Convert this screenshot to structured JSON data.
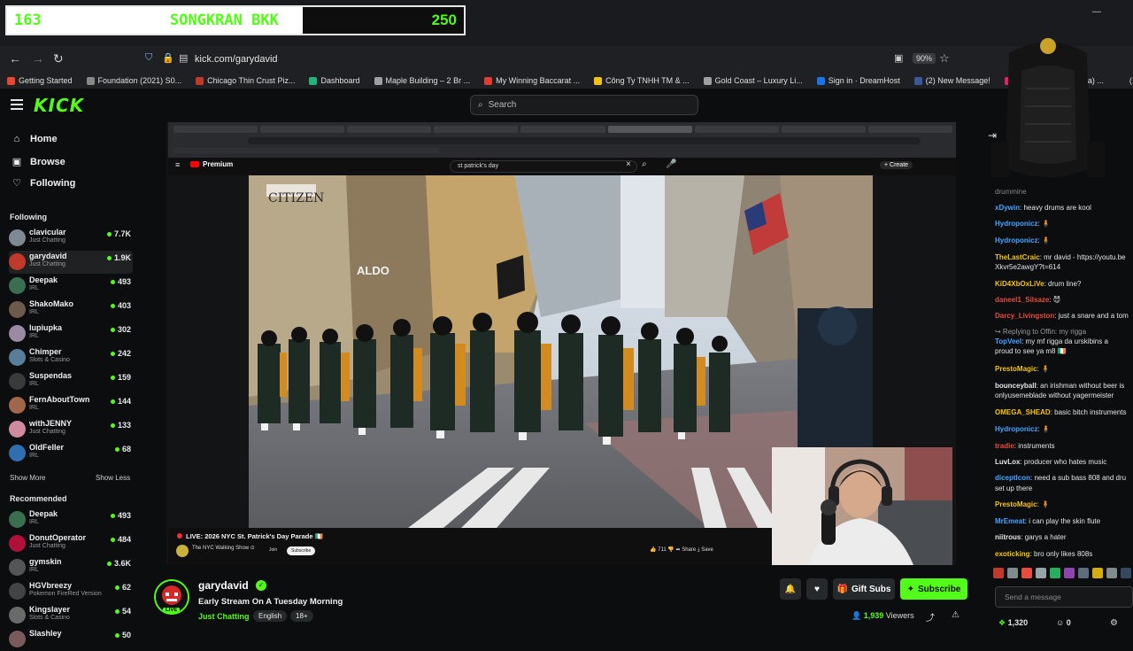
{
  "browser": {
    "overlay": {
      "left_num": "163",
      "title": "SONGKRAN BKK",
      "right_num": "250"
    },
    "url": "kick.com/garydavid",
    "zoom": "90%",
    "bookmarks": [
      {
        "label": "Getting Started",
        "color": "#e8472f"
      },
      {
        "label": "Foundation (2021) S0...",
        "color": "#888888"
      },
      {
        "label": "Chicago Thin Crust Piz...",
        "color": "#c0392b"
      },
      {
        "label": "Dashboard",
        "color": "#23b37a"
      },
      {
        "label": "Maple Building – 2 Br ...",
        "color": "#a0a0a0"
      },
      {
        "label": "My Winning Baccarat ...",
        "color": "#e03c31"
      },
      {
        "label": "Công Ty TNHH TM & ...",
        "color": "#f1c40f"
      },
      {
        "label": "Gold Coast – Luxury Li...",
        "color": "#a0a0a0"
      },
      {
        "label": "Sign in · DreamHost",
        "color": "#1a73e8"
      },
      {
        "label": "(2) New Message!",
        "color": "#3b5998"
      },
      {
        "label": "Voice (Korean Drama) ...",
        "color": "#e91e63"
      },
      {
        "label": "(1) N",
        "color": "#1f1f1f"
      }
    ]
  },
  "header": {
    "logo": "KICK",
    "search_placeholder": "Search"
  },
  "sidebar": {
    "nav": [
      {
        "label": "Home",
        "icon": "home-icon"
      },
      {
        "label": "Browse",
        "icon": "browse-icon"
      },
      {
        "label": "Following",
        "icon": "heart-icon"
      }
    ],
    "following_title": "Following",
    "following": [
      {
        "name": "clavicular",
        "category": "Just Chatting",
        "viewers": "7.7K",
        "avatar": "#7d8a93"
      },
      {
        "name": "garydavid",
        "category": "Just Chatting",
        "viewers": "1.9K",
        "avatar": "#c0392b",
        "active": true
      },
      {
        "name": "Deepak",
        "category": "IRL",
        "viewers": "493",
        "avatar": "#3b6e4f"
      },
      {
        "name": "ShakoMako",
        "category": "IRL",
        "viewers": "403",
        "avatar": "#6e5a4a"
      },
      {
        "name": "lupiupka",
        "category": "IRL",
        "viewers": "302",
        "avatar": "#9b8aa6"
      },
      {
        "name": "Chimper",
        "category": "Slots & Casino",
        "viewers": "242",
        "avatar": "#5a7d9a"
      },
      {
        "name": "Suspendas",
        "category": "IRL",
        "viewers": "159",
        "avatar": "#3a3a3a"
      },
      {
        "name": "FernAboutTown",
        "category": "IRL",
        "viewers": "144",
        "avatar": "#a0674a"
      },
      {
        "name": "withJENNY",
        "category": "Just Chatting",
        "viewers": "133",
        "avatar": "#d08aa0"
      },
      {
        "name": "OldFeller",
        "category": "IRL",
        "viewers": "68",
        "avatar": "#2f6fb0"
      }
    ],
    "show_more": "Show More",
    "show_less": "Show Less",
    "recommended_title": "Recommended",
    "recommended": [
      {
        "name": "Deepak",
        "category": "IRL",
        "viewers": "493",
        "avatar": "#3b6e4f"
      },
      {
        "name": "DonutOperator",
        "category": "Just Chatting",
        "viewers": "484",
        "avatar": "#b0103a"
      },
      {
        "name": "gymskin",
        "category": "IRL",
        "viewers": "3.6K",
        "avatar": "#555555"
      },
      {
        "name": "HGVbreezy",
        "category": "Pokemon FireRed Version",
        "viewers": "62",
        "avatar": "#444444"
      },
      {
        "name": "Kingslayer",
        "category": "Slots & Casino",
        "viewers": "54",
        "avatar": "#6a6a6a"
      },
      {
        "name": "Slashley",
        "category": "",
        "viewers": "50",
        "avatar": "#7a5a5a"
      }
    ]
  },
  "video": {
    "yt_search": "st patrick's day",
    "yt_premium": "Premium",
    "yt_title": "LIVE: 2026 NYC St. Patrick's Day Parade 🇮🇪",
    "yt_channel": "The NYC Walking Show ⊙",
    "yt_join": "Join",
    "yt_subscribe": "Subscribe",
    "yt_actions": "👍 711   👎   ➦ Share   ⤓ Save",
    "scene_signs": [
      "CITIZEN",
      "ALDO"
    ]
  },
  "stream": {
    "name": "garydavid",
    "title": "Early Stream On A Tuesday Morning",
    "category": "Just Chatting",
    "tags": [
      "English",
      "18+"
    ],
    "live": "LIVE",
    "viewers": "1,939",
    "viewers_label": "Viewers",
    "gift_subs": "Gift Subs",
    "subscribe": "Subscribe"
  },
  "chat": {
    "messages": [
      {
        "user": "xDywin",
        "color": "#4aa3ff",
        "text": "heavy drums are kool"
      },
      {
        "user": "Hydroponicz",
        "color": "#4aa3ff",
        "text": "🧍"
      },
      {
        "user": "Hydroponicz",
        "color": "#4aa3ff",
        "text": "🧍"
      },
      {
        "user": "TheLastCraic",
        "color": "#f5c518",
        "text": "mr david - https://youtu.be"
      },
      {
        "user": "",
        "color": "#e6e6e6",
        "text": "Xkvr5e2awgY?t=614"
      },
      {
        "user": "KiD4XbOxLiVe",
        "color": "#f5c518",
        "text": "drum line?"
      },
      {
        "user": "daneel1_Silsaze",
        "color": "#e74c3c",
        "text": "😈"
      },
      {
        "user": "Darcy_Livingston",
        "color": "#e74c3c",
        "text": "just a snare and a tom"
      },
      {
        "user": "",
        "color": "#9a9a9a",
        "text": "↪ Replying to Offin: my rigga"
      },
      {
        "user": "TopVeel",
        "color": "#4aa3ff",
        "text": "my mf rigga da urskibins a"
      },
      {
        "user": "",
        "color": "#e6e6e6",
        "text": "proud to see ya m8 🇮🇪"
      },
      {
        "user": "PrestoMagic",
        "color": "#f5c518",
        "text": "🧍"
      },
      {
        "user": "bounceyball",
        "color": "#e6e6e6",
        "text": "an irishman without beer is"
      },
      {
        "user": "",
        "color": "#e6e6e6",
        "text": "onlyusemeblade without yagermeister"
      },
      {
        "user": "OMEGA_SHEAD",
        "color": "#f5c518",
        "text": "basic bitch instruments"
      },
      {
        "user": "Hydroponicz",
        "color": "#4aa3ff",
        "text": "🧍"
      },
      {
        "user": "tradie",
        "color": "#e74c3c",
        "text": "instruments"
      },
      {
        "user": "LuvLox",
        "color": "#e6e6e6",
        "text": "producer who hates music"
      },
      {
        "user": "diceptlcon",
        "color": "#4aa3ff",
        "text": "need a sub bass 808 and dru"
      },
      {
        "user": "",
        "color": "#e6e6e6",
        "text": "set up there"
      },
      {
        "user": "PrestoMagic",
        "color": "#f5c518",
        "text": "🧍"
      },
      {
        "user": "MrEmeat",
        "color": "#4aa3ff",
        "text": "i can play the skin flute"
      },
      {
        "user": "niitrous",
        "color": "#e6e6e6",
        "text": "garys a hater"
      },
      {
        "user": "exoticking",
        "color": "#f5c518",
        "text": "bro only likes 808s"
      }
    ],
    "input_placeholder": "Send a message",
    "points": "1,320",
    "count": "0",
    "top_partial": "drummine"
  }
}
